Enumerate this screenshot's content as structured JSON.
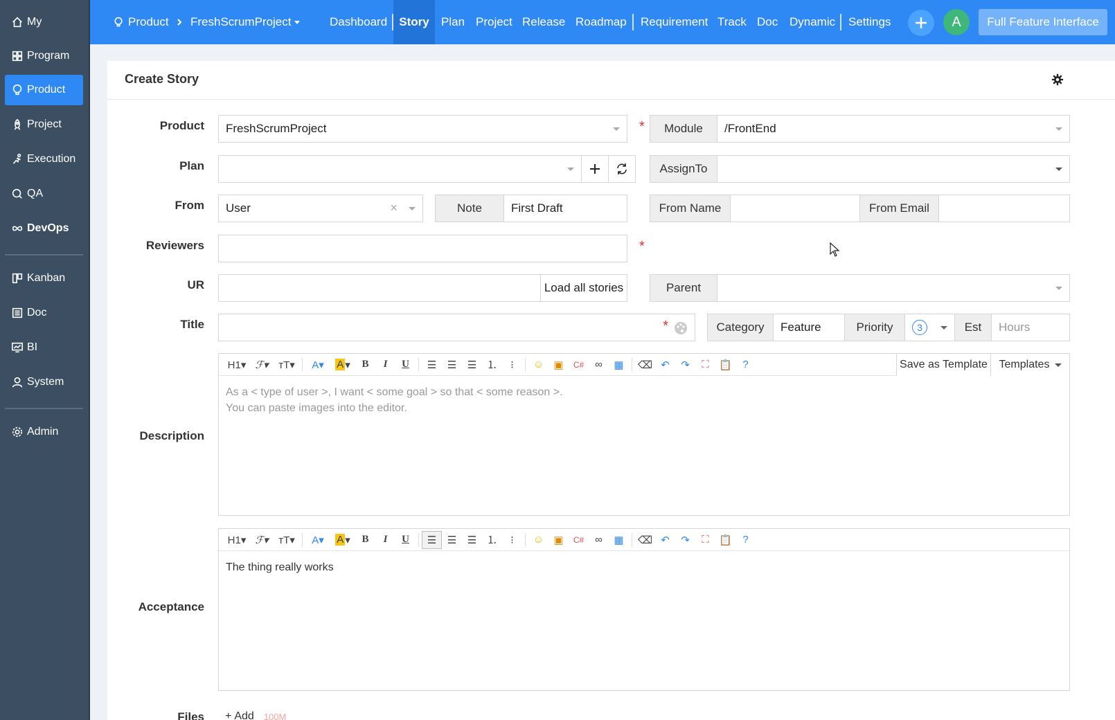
{
  "sidebar": {
    "items": [
      {
        "label": "My",
        "icon": "home-icon"
      },
      {
        "label": "Program",
        "icon": "grid-icon"
      },
      {
        "label": "Product",
        "icon": "lightbulb-icon"
      },
      {
        "label": "Project",
        "icon": "rocket-icon"
      },
      {
        "label": "Execution",
        "icon": "runner-icon"
      },
      {
        "label": "QA",
        "icon": "magnifier-icon"
      },
      {
        "label": "DevOps",
        "icon": "infinity-icon"
      },
      {
        "label": "Kanban",
        "icon": "kanban-icon"
      },
      {
        "label": "Doc",
        "icon": "list-doc-icon"
      },
      {
        "label": "BI",
        "icon": "monitor-chart-icon"
      },
      {
        "label": "System",
        "icon": "user-icon"
      },
      {
        "label": "Admin",
        "icon": "gear-icon"
      }
    ]
  },
  "topbar": {
    "breadcrumb_root": "Product",
    "breadcrumb_current": "FreshScrumProject",
    "nav": [
      "Dashboard",
      "Story",
      "Plan",
      "Project",
      "Release",
      "Roadmap",
      "Requirement",
      "Track",
      "Doc",
      "Dynamic",
      "Settings"
    ],
    "active_nav": "Story",
    "avatar_letter": "A",
    "full_feature_label": "Full Feature Interface"
  },
  "form": {
    "title": "Create Story",
    "product_label": "Product",
    "product_value": "FreshScrumProject",
    "module_label": "Module",
    "module_value": "/FrontEnd",
    "plan_label": "Plan",
    "plan_value": "",
    "assign_label": "AssignTo",
    "assign_value": "",
    "from_label": "From",
    "from_value": "User",
    "note_label": "Note",
    "note_value": "First Draft",
    "from_name_label": "From Name",
    "from_name_value": "",
    "from_email_label": "From Email",
    "from_email_value": "",
    "reviewers_label": "Reviewers",
    "reviewers_value": "",
    "ur_label": "UR",
    "ur_value": "",
    "load_all_label": "Load all stories",
    "parent_label": "Parent",
    "parent_value": "",
    "title_label": "Title",
    "title_value": "",
    "category_label": "Category",
    "category_value": "Feature",
    "priority_label": "Priority",
    "priority_value": "3",
    "est_label": "Est",
    "est_placeholder": "Hours",
    "description_label": "Description",
    "description_placeholder_1": "As a < type of user >, I want < some goal > so that < some reason >.",
    "description_placeholder_2": "You can paste images into the editor.",
    "save_template_label": "Save as Template",
    "templates_label": "Templates",
    "acceptance_label": "Acceptance",
    "acceptance_value": "The thing really works",
    "files_label": "Files",
    "add_label": "Add",
    "size_limit": "100M"
  },
  "colors": {
    "brand": "#2f89f5",
    "sidebar": "#3b4e62",
    "required": "#e0302c"
  }
}
